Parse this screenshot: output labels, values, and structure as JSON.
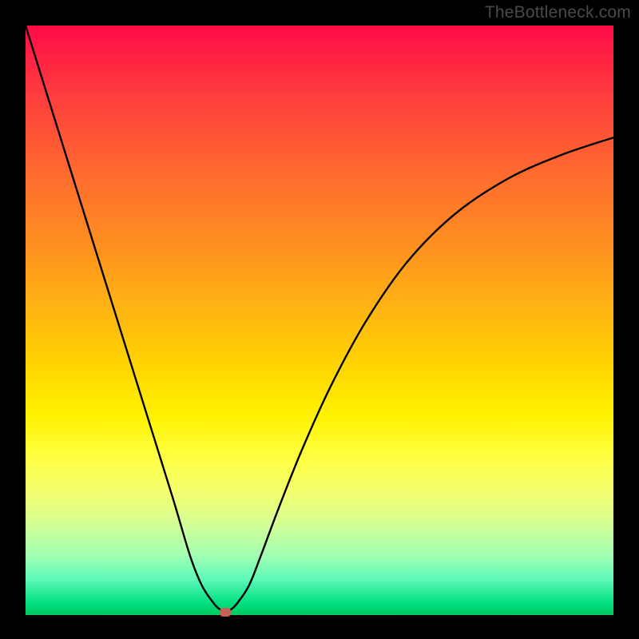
{
  "watermark": "TheBottleneck.com",
  "chart_data": {
    "type": "line",
    "title": "",
    "xlabel": "",
    "ylabel": "",
    "xlim": [
      0,
      100
    ],
    "ylim": [
      0,
      100
    ],
    "series": [
      {
        "name": "curve",
        "x": [
          0,
          5,
          10,
          15,
          20,
          25,
          28,
          30,
          32,
          33,
          34,
          35,
          36,
          38,
          40,
          43,
          47,
          52,
          58,
          65,
          73,
          82,
          91,
          100
        ],
        "y": [
          100,
          84,
          68,
          52,
          36,
          20,
          10,
          5,
          2,
          1,
          0.5,
          1,
          2,
          5,
          10,
          18,
          28,
          39,
          50,
          60,
          68,
          74,
          78,
          81
        ]
      }
    ],
    "marker": {
      "x": 34,
      "y": 0.5
    },
    "gradient_stops": [
      {
        "pos": 0,
        "color": "#ff0b46"
      },
      {
        "pos": 12,
        "color": "#ff3e3e"
      },
      {
        "pos": 25,
        "color": "#ff6a2f"
      },
      {
        "pos": 37,
        "color": "#ff8f20"
      },
      {
        "pos": 48,
        "color": "#ffb412"
      },
      {
        "pos": 58,
        "color": "#ffd500"
      },
      {
        "pos": 66,
        "color": "#fff200"
      },
      {
        "pos": 73,
        "color": "#ffff40"
      },
      {
        "pos": 79,
        "color": "#f4ff6e"
      },
      {
        "pos": 84,
        "color": "#d9ff91"
      },
      {
        "pos": 90,
        "color": "#a0ffb4"
      },
      {
        "pos": 94,
        "color": "#5cf8b8"
      },
      {
        "pos": 98,
        "color": "#00e07f"
      },
      {
        "pos": 100,
        "color": "#00c85e"
      }
    ]
  }
}
